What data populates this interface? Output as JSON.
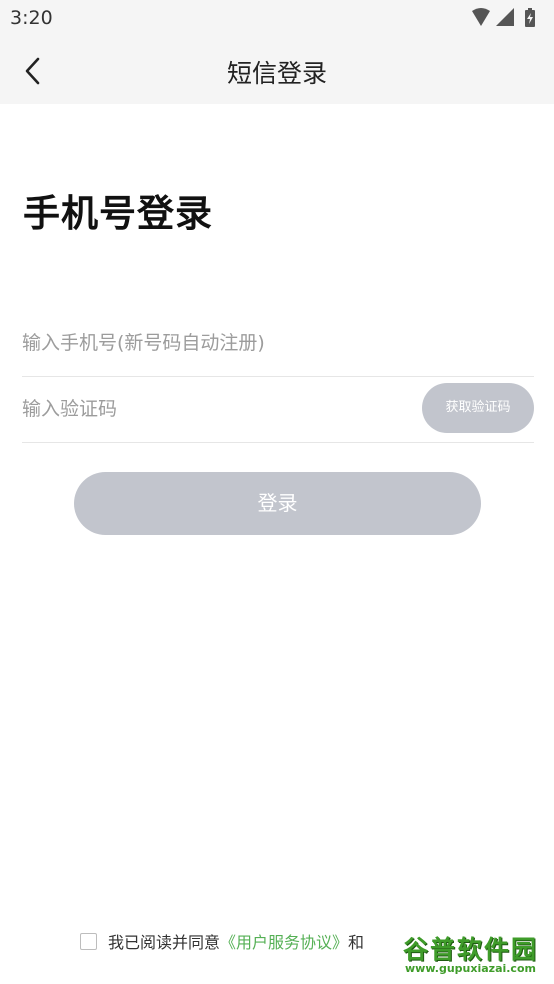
{
  "status_bar": {
    "time": "3:20",
    "icons": [
      "wifi-icon",
      "signal-icon",
      "battery-icon"
    ]
  },
  "header": {
    "title": "短信登录",
    "back_icon": "chevron-left-icon"
  },
  "main": {
    "heading": "手机号登录",
    "phone_placeholder": "输入手机号(新号码自动注册)",
    "code_placeholder": "输入验证码",
    "get_code_label": "获取验证码",
    "login_label": "登录"
  },
  "agreement": {
    "prefix": "我已阅读并同意",
    "user_agreement": "《用户服务协议》",
    "and": "和"
  },
  "watermark": {
    "brand": "谷普软件园",
    "url": "www.gupuxiazai.com"
  },
  "colors": {
    "accent_green": "#55b055",
    "disabled_button": "#c2c5cd",
    "header_bg": "#f5f5f5"
  }
}
